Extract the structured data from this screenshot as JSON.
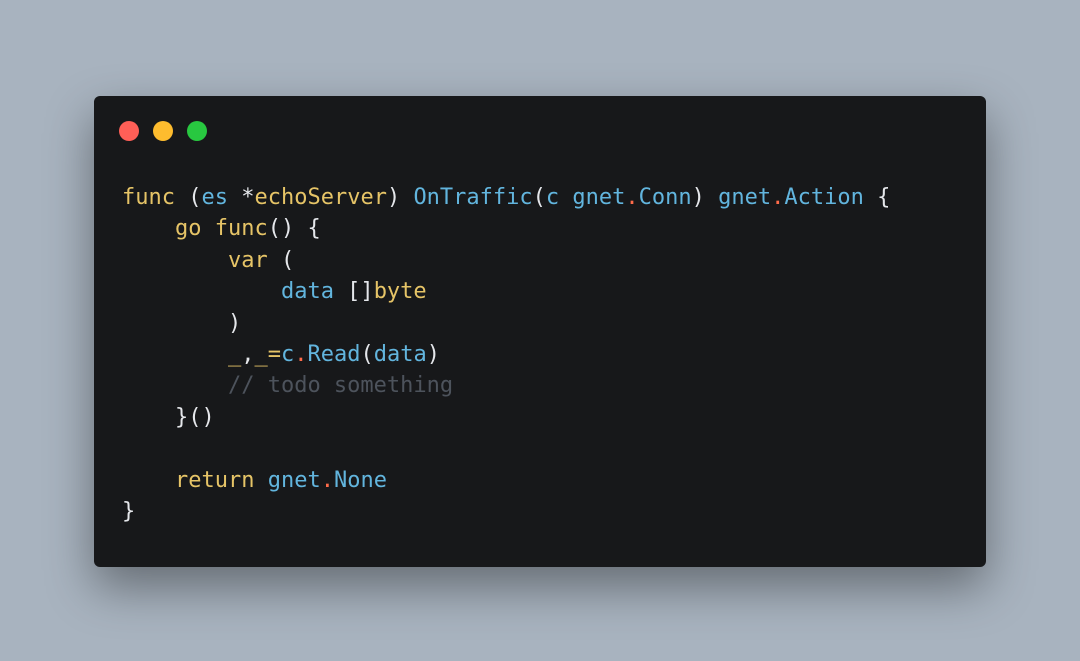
{
  "window": {
    "colors": {
      "page_background": "#a8b3bf",
      "window_background": "#17181a",
      "close_dot": "#ff5f57",
      "minimize_dot": "#febc2e",
      "maximize_dot": "#28c840",
      "keyword": "#e6c467",
      "identifier": "#62b5de",
      "operator_dot": "#ff6b4a",
      "punctuation": "#e5e7eb",
      "comment": "#4d535c"
    }
  },
  "code": {
    "l1": {
      "func": "func",
      "open": " (",
      "recv": "es",
      "star": " *",
      "recvType": "echoServer",
      "close": ") ",
      "method": "OnTraffic",
      "p_open": "(",
      "param": "c",
      "space": " ",
      "pkg1": "gnet",
      "dot1": ".",
      "type1": "Conn",
      "p_close": ") ",
      "pkg2": "gnet",
      "dot2": ".",
      "type2": "Action",
      "brace": " {"
    },
    "l2": {
      "indent": "    ",
      "go": "go",
      "sp": " ",
      "func": "func",
      "rest": "() {"
    },
    "l3": {
      "indent": "        ",
      "var": "var",
      "rest": " ("
    },
    "l4": {
      "indent": "            ",
      "name": "data",
      "brackets": " []",
      "type": "byte"
    },
    "l5": {
      "indent": "        ",
      "rest": ")"
    },
    "l6": {
      "indent": "        ",
      "u1": "_",
      "comma": ",",
      "u2": "_",
      "eq": "=",
      "obj": "c",
      "dot": ".",
      "method": "Read",
      "open": "(",
      "arg": "data",
      "close": ")"
    },
    "l7": {
      "indent": "        ",
      "comment": "// todo something"
    },
    "l8": {
      "indent": "    ",
      "rest": "}()"
    },
    "l9": {
      "text": " "
    },
    "l10": {
      "indent": "    ",
      "ret": "return",
      "sp": " ",
      "pkg": "gnet",
      "dot": ".",
      "val": "None"
    },
    "l11": {
      "rest": "}"
    }
  }
}
